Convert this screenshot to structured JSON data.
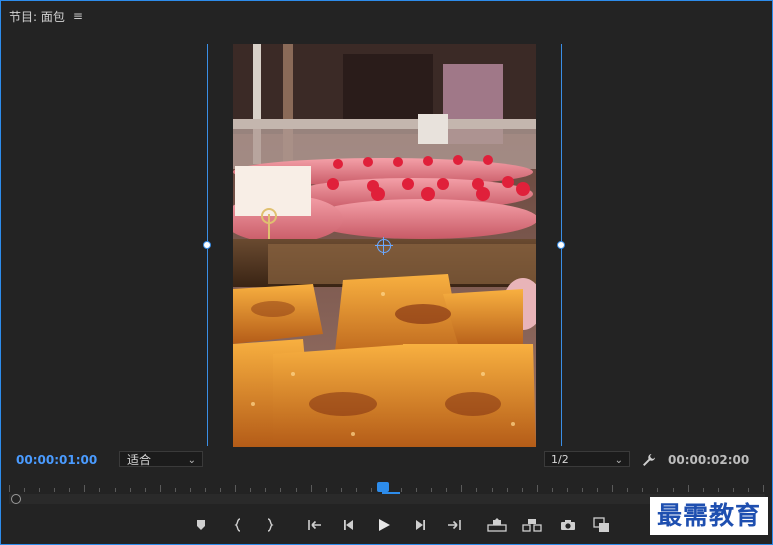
{
  "panel": {
    "title": "节目: 面包",
    "menu_icon": "hamburger-menu-icon"
  },
  "viewer": {
    "guide_color": "#3a8ee6",
    "photo_subject": "bakery-pastry-display"
  },
  "timecode": {
    "current": "00:00:01:00",
    "duration": "00:00:02:00",
    "current_color": "#4a9bff"
  },
  "zoom": {
    "selected": "适合"
  },
  "resolution": {
    "selected": "1/2"
  },
  "transport": {
    "buttons": [
      {
        "name": "add-marker-button",
        "icon": "marker-icon"
      },
      {
        "name": "mark-in-button",
        "icon": "mark-in-icon"
      },
      {
        "name": "mark-out-button",
        "icon": "mark-out-icon"
      },
      {
        "name": "go-to-in-button",
        "icon": "go-to-in-icon"
      },
      {
        "name": "step-back-button",
        "icon": "step-back-icon"
      },
      {
        "name": "play-button",
        "icon": "play-icon"
      },
      {
        "name": "step-forward-button",
        "icon": "step-forward-icon"
      },
      {
        "name": "go-to-out-button",
        "icon": "go-to-out-icon"
      },
      {
        "name": "lift-button",
        "icon": "lift-icon"
      },
      {
        "name": "extract-button",
        "icon": "extract-icon"
      },
      {
        "name": "export-frame-button",
        "icon": "camera-icon"
      },
      {
        "name": "compare-view-button",
        "icon": "compare-icon"
      }
    ]
  },
  "watermark": {
    "text": "最需教育"
  },
  "accent_color": "#2d8ceb"
}
